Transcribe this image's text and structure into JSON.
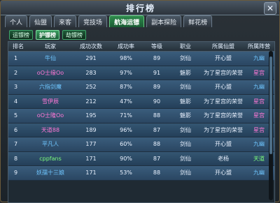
{
  "window": {
    "title": "排行榜",
    "close_glyph": "✕"
  },
  "tabs": [
    {
      "label": "个人",
      "active": false
    },
    {
      "label": "仙盟",
      "active": false
    },
    {
      "label": "来客",
      "active": false
    },
    {
      "label": "竞技场",
      "active": false
    },
    {
      "label": "航海运镖",
      "active": true
    },
    {
      "label": "副本探险",
      "active": false
    },
    {
      "label": "鲜花榜",
      "active": false
    }
  ],
  "subtabs": [
    {
      "label": "运镖榜",
      "active": false
    },
    {
      "label": "护镖榜",
      "active": true
    },
    {
      "label": "劫镖榜",
      "active": false
    }
  ],
  "table": {
    "headers": [
      "排名",
      "玩家",
      "成功次数",
      "成功率",
      "等级",
      "职业",
      "所属仙盟",
      "所属阵营"
    ],
    "rows": [
      {
        "rank": "1",
        "player": "牛仙",
        "success": "291",
        "rate": "98%",
        "level": "89",
        "class": "剑仙",
        "alliance": "开心盟",
        "camp": "九幽"
      },
      {
        "rank": "2",
        "player": "oO士缘Oo",
        "success": "283",
        "rate": "97%",
        "level": "91",
        "class": "魅影",
        "alliance": "为了星宫的荣誉",
        "camp": "星宫"
      },
      {
        "rank": "3",
        "player": "六指剑魔",
        "success": "252",
        "rate": "87%",
        "level": "89",
        "class": "剑仙",
        "alliance": "开心盟",
        "camp": "九幽"
      },
      {
        "rank": "4",
        "player": "雪伊辰",
        "success": "212",
        "rate": "47%",
        "level": "90",
        "class": "魅影",
        "alliance": "为了星宫的荣誉",
        "camp": "星宫"
      },
      {
        "rank": "5",
        "player": "oO士隆Oo",
        "success": "195",
        "rate": "71%",
        "level": "88",
        "class": "魅影",
        "alliance": "为了星宫的荣誉",
        "camp": "星宫"
      },
      {
        "rank": "6",
        "player": "天道88",
        "success": "189",
        "rate": "96%",
        "level": "87",
        "class": "剑仙",
        "alliance": "为了星宫的荣誉",
        "camp": "星宫"
      },
      {
        "rank": "7",
        "player": "平凡人",
        "success": "177",
        "rate": "60%",
        "level": "88",
        "class": "剑仙",
        "alliance": "开心盟",
        "camp": "九幽"
      },
      {
        "rank": "8",
        "player": "cppfans",
        "success": "171",
        "rate": "90%",
        "level": "87",
        "class": "剑仙",
        "alliance": "老杨",
        "camp": "天道"
      },
      {
        "rank": "9",
        "player": "妖孺十三娘",
        "success": "171",
        "rate": "53%",
        "level": "88",
        "class": "剑仙",
        "alliance": "开心盟",
        "camp": "九幽"
      }
    ],
    "row_colors": {
      "row_player": [
        "blue",
        "pink",
        "blue",
        "pink",
        "pink",
        "pink",
        "blue",
        "green",
        "blue"
      ],
      "row_camp": [
        "blue",
        "pink",
        "blue",
        "pink",
        "pink",
        "pink",
        "blue",
        "green",
        "blue"
      ]
    }
  },
  "colors": {
    "pink": "#ff77d6",
    "blue": "#6fc6ff",
    "green": "#7dff7d"
  }
}
